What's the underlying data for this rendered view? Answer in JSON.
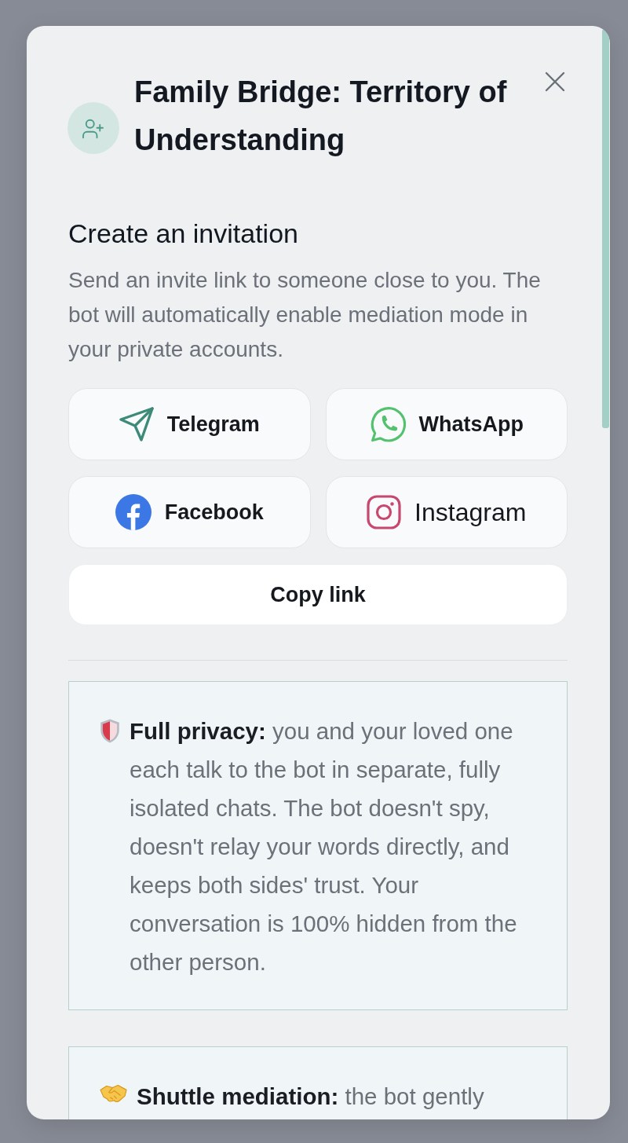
{
  "dialog": {
    "title": "Family Bridge: Territory of Understanding"
  },
  "invitation": {
    "heading": "Create an invitation",
    "description": "Send an invite link to someone close to you. The bot will automatically enable mediation mode in your private accounts."
  },
  "share_buttons": [
    {
      "label": "Telegram",
      "bold": true
    },
    {
      "label": "WhatsApp",
      "bold": true
    },
    {
      "label": "Facebook",
      "bold": true
    },
    {
      "label": "Instagram",
      "bold": false
    }
  ],
  "copy_button": {
    "label": "Copy link"
  },
  "info_cards": [
    {
      "text": "**Full privacy:** you and your loved one each talk to the bot in separate, fully isolated chats. The bot doesn't spy, doesn't relay your words directly, and keeps both sides' trust. Your conversation is 100% hidden from the other person."
    },
    {
      "text": "**Shuttle mediation:** the bot gently"
    }
  ]
}
